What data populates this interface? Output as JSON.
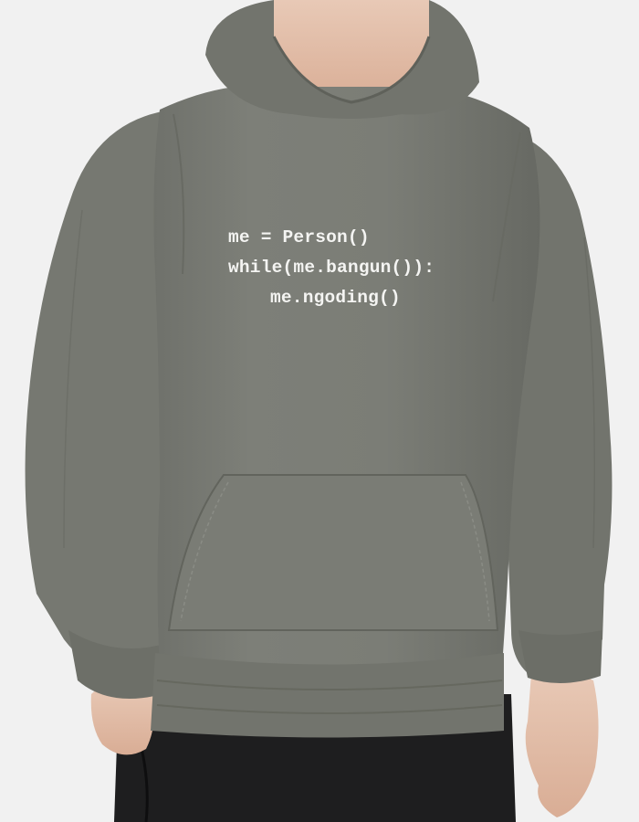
{
  "product": {
    "type": "hoodie",
    "color": "#7b7d76",
    "pants_color": "#1e1e1f",
    "background_color": "#f1f1f1"
  },
  "print": {
    "lines": [
      "me = Person()",
      "while(me.bangun()):",
      "me.ngoding()"
    ],
    "text_color": "#f4f4f2"
  }
}
